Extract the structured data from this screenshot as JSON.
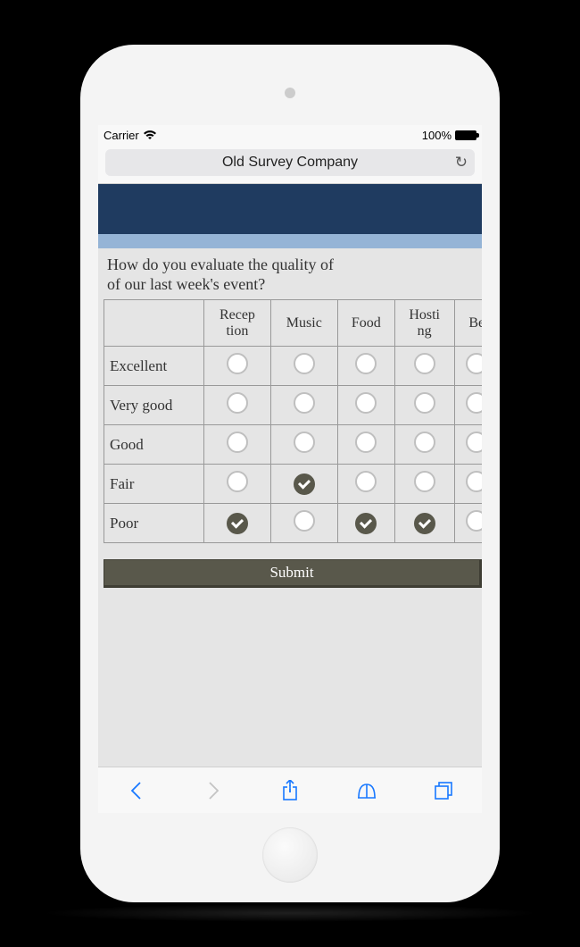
{
  "status": {
    "carrier": "Carrier",
    "battery_pct": "100%"
  },
  "browser": {
    "title": "Old Survey Company"
  },
  "survey": {
    "question_line1": "How do you evaluate the quality of",
    "question_line2": "of our last week's event?",
    "columns": [
      "Reception",
      "Music",
      "Food",
      "Hosting",
      "Be"
    ],
    "rows": [
      "Excellent",
      "Very good",
      "Good",
      "Fair",
      "Poor"
    ],
    "selections": {
      "Reception": "Poor",
      "Music": "Fair",
      "Food": "Poor",
      "Hosting": "Poor",
      "Be": null
    },
    "submit_label": "Submit"
  }
}
